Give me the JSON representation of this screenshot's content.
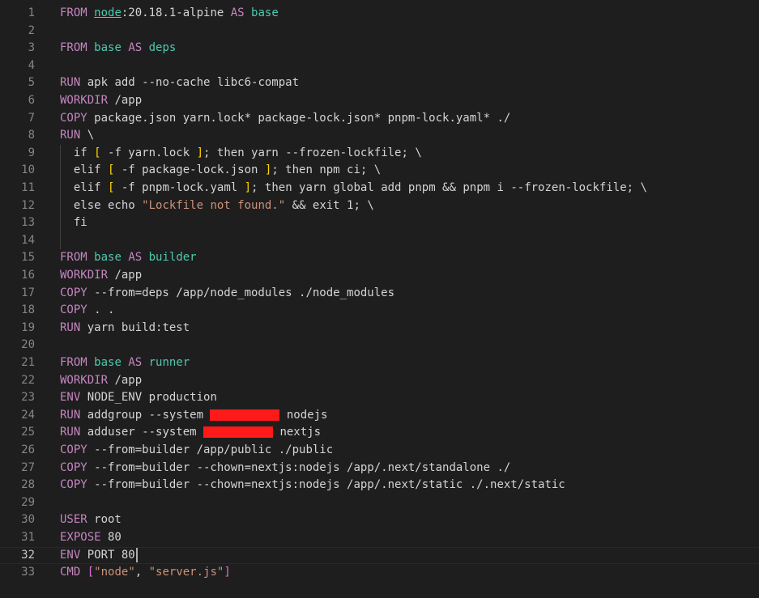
{
  "editor": {
    "active_line": 32,
    "colors": {
      "keyword": "#c586c0",
      "identifier": "#4ec9b0",
      "text": "#d4d4d4",
      "string": "#ce9178",
      "number": "#b5cea8",
      "bracket": "#ffd700",
      "bracket2": "#da70d6",
      "escape": "#d4d4d4",
      "redaction": "#ff1a1a"
    },
    "lines": [
      {
        "n": "1",
        "tokens": [
          {
            "t": "FROM",
            "c": "keyword"
          },
          {
            "t": " ",
            "c": "text"
          },
          {
            "t": "node",
            "c": "identifier",
            "u": true
          },
          {
            "t": ":20.18.1-alpine ",
            "c": "text"
          },
          {
            "t": "AS",
            "c": "keyword"
          },
          {
            "t": " ",
            "c": "text"
          },
          {
            "t": "base",
            "c": "identifier"
          }
        ]
      },
      {
        "n": "2",
        "tokens": []
      },
      {
        "n": "3",
        "tokens": [
          {
            "t": "FROM",
            "c": "keyword"
          },
          {
            "t": " ",
            "c": "text"
          },
          {
            "t": "base",
            "c": "identifier"
          },
          {
            "t": " ",
            "c": "text"
          },
          {
            "t": "AS",
            "c": "keyword"
          },
          {
            "t": " ",
            "c": "text"
          },
          {
            "t": "deps",
            "c": "identifier"
          }
        ]
      },
      {
        "n": "4",
        "tokens": []
      },
      {
        "n": "5",
        "tokens": [
          {
            "t": "RUN",
            "c": "keyword"
          },
          {
            "t": " apk add --no-cache libc6-compat",
            "c": "text"
          }
        ]
      },
      {
        "n": "6",
        "tokens": [
          {
            "t": "WORKDIR",
            "c": "keyword"
          },
          {
            "t": " /app",
            "c": "text"
          }
        ]
      },
      {
        "n": "7",
        "tokens": [
          {
            "t": "COPY",
            "c": "keyword"
          },
          {
            "t": " package.json yarn.lock* package-lock.json* pnpm-lock.yaml* ./",
            "c": "text"
          }
        ]
      },
      {
        "n": "8",
        "tokens": [
          {
            "t": "RUN",
            "c": "keyword"
          },
          {
            "t": " \\",
            "c": "text"
          }
        ]
      },
      {
        "n": "9",
        "tokens": [
          {
            "t": "  if ",
            "c": "text"
          },
          {
            "t": "[",
            "c": "bracket"
          },
          {
            "t": " -f yarn.lock ",
            "c": "text"
          },
          {
            "t": "]",
            "c": "bracket"
          },
          {
            "t": "; then yarn --frozen-lockfile; \\",
            "c": "text"
          }
        ]
      },
      {
        "n": "10",
        "tokens": [
          {
            "t": "  elif ",
            "c": "text"
          },
          {
            "t": "[",
            "c": "bracket"
          },
          {
            "t": " -f package-lock.json ",
            "c": "text"
          },
          {
            "t": "]",
            "c": "bracket"
          },
          {
            "t": "; then npm ci; \\",
            "c": "text"
          }
        ]
      },
      {
        "n": "11",
        "tokens": [
          {
            "t": "  elif ",
            "c": "text"
          },
          {
            "t": "[",
            "c": "bracket"
          },
          {
            "t": " -f pnpm-lock.yaml ",
            "c": "text"
          },
          {
            "t": "]",
            "c": "bracket"
          },
          {
            "t": "; then yarn global add pnpm && pnpm i --frozen-lockfile; \\",
            "c": "text"
          }
        ]
      },
      {
        "n": "12",
        "tokens": [
          {
            "t": "  else echo ",
            "c": "text"
          },
          {
            "t": "\"Lockfile not found.\"",
            "c": "string"
          },
          {
            "t": " && exit 1; \\",
            "c": "text"
          }
        ]
      },
      {
        "n": "13",
        "tokens": [
          {
            "t": "  fi",
            "c": "text"
          }
        ]
      },
      {
        "n": "14",
        "tokens": []
      },
      {
        "n": "15",
        "tokens": [
          {
            "t": "FROM",
            "c": "keyword"
          },
          {
            "t": " ",
            "c": "text"
          },
          {
            "t": "base",
            "c": "identifier"
          },
          {
            "t": " ",
            "c": "text"
          },
          {
            "t": "AS",
            "c": "keyword"
          },
          {
            "t": " ",
            "c": "text"
          },
          {
            "t": "builder",
            "c": "identifier"
          }
        ]
      },
      {
        "n": "16",
        "tokens": [
          {
            "t": "WORKDIR",
            "c": "keyword"
          },
          {
            "t": " /app",
            "c": "text"
          }
        ]
      },
      {
        "n": "17",
        "tokens": [
          {
            "t": "COPY",
            "c": "keyword"
          },
          {
            "t": " --from=deps /app/node_modules ./node_modules",
            "c": "text"
          }
        ]
      },
      {
        "n": "18",
        "tokens": [
          {
            "t": "COPY",
            "c": "keyword"
          },
          {
            "t": " . .",
            "c": "text"
          }
        ]
      },
      {
        "n": "19",
        "tokens": [
          {
            "t": "RUN",
            "c": "keyword"
          },
          {
            "t": " yarn build:test",
            "c": "text"
          }
        ]
      },
      {
        "n": "20",
        "tokens": []
      },
      {
        "n": "21",
        "tokens": [
          {
            "t": "FROM",
            "c": "keyword"
          },
          {
            "t": " ",
            "c": "text"
          },
          {
            "t": "base",
            "c": "identifier"
          },
          {
            "t": " ",
            "c": "text"
          },
          {
            "t": "AS",
            "c": "keyword"
          },
          {
            "t": " ",
            "c": "text"
          },
          {
            "t": "runner",
            "c": "identifier"
          }
        ]
      },
      {
        "n": "22",
        "tokens": [
          {
            "t": "WORKDIR",
            "c": "keyword"
          },
          {
            "t": " /app",
            "c": "text"
          }
        ]
      },
      {
        "n": "23",
        "tokens": [
          {
            "t": "ENV",
            "c": "keyword"
          },
          {
            "t": " NODE_ENV production",
            "c": "text"
          }
        ]
      },
      {
        "n": "24",
        "tokens": [
          {
            "t": "RUN",
            "c": "keyword"
          },
          {
            "t": " addgroup --system ",
            "c": "text"
          },
          {
            "t": "",
            "c": "redaction",
            "w": 86
          },
          {
            "t": " nodejs",
            "c": "text"
          }
        ]
      },
      {
        "n": "25",
        "tokens": [
          {
            "t": "RUN",
            "c": "keyword"
          },
          {
            "t": " adduser --system ",
            "c": "text"
          },
          {
            "t": "",
            "c": "redaction",
            "w": 86
          },
          {
            "t": " nextjs",
            "c": "text"
          }
        ]
      },
      {
        "n": "26",
        "tokens": [
          {
            "t": "COPY",
            "c": "keyword"
          },
          {
            "t": " --from=builder /app/public ./public",
            "c": "text"
          }
        ]
      },
      {
        "n": "27",
        "tokens": [
          {
            "t": "COPY",
            "c": "keyword"
          },
          {
            "t": " --from=builder --chown=nextjs:nodejs /app/.next/standalone ./",
            "c": "text"
          }
        ]
      },
      {
        "n": "28",
        "tokens": [
          {
            "t": "COPY",
            "c": "keyword"
          },
          {
            "t": " --from=builder --chown=nextjs:nodejs /app/.next/static ./.next/static",
            "c": "text"
          }
        ]
      },
      {
        "n": "29",
        "tokens": []
      },
      {
        "n": "30",
        "tokens": [
          {
            "t": "USER",
            "c": "keyword"
          },
          {
            "t": " root",
            "c": "text"
          }
        ]
      },
      {
        "n": "31",
        "tokens": [
          {
            "t": "EXPOSE",
            "c": "keyword"
          },
          {
            "t": " 80",
            "c": "text"
          }
        ]
      },
      {
        "n": "32",
        "tokens": [
          {
            "t": "ENV",
            "c": "keyword"
          },
          {
            "t": " PORT 80",
            "c": "text"
          }
        ],
        "cursor": true
      },
      {
        "n": "33",
        "tokens": [
          {
            "t": "CMD",
            "c": "keyword"
          },
          {
            "t": " ",
            "c": "text"
          },
          {
            "t": "[",
            "c": "bracket2"
          },
          {
            "t": "\"node\"",
            "c": "string"
          },
          {
            "t": ", ",
            "c": "text"
          },
          {
            "t": "\"server.js\"",
            "c": "string"
          },
          {
            "t": "]",
            "c": "bracket2"
          }
        ]
      }
    ]
  }
}
